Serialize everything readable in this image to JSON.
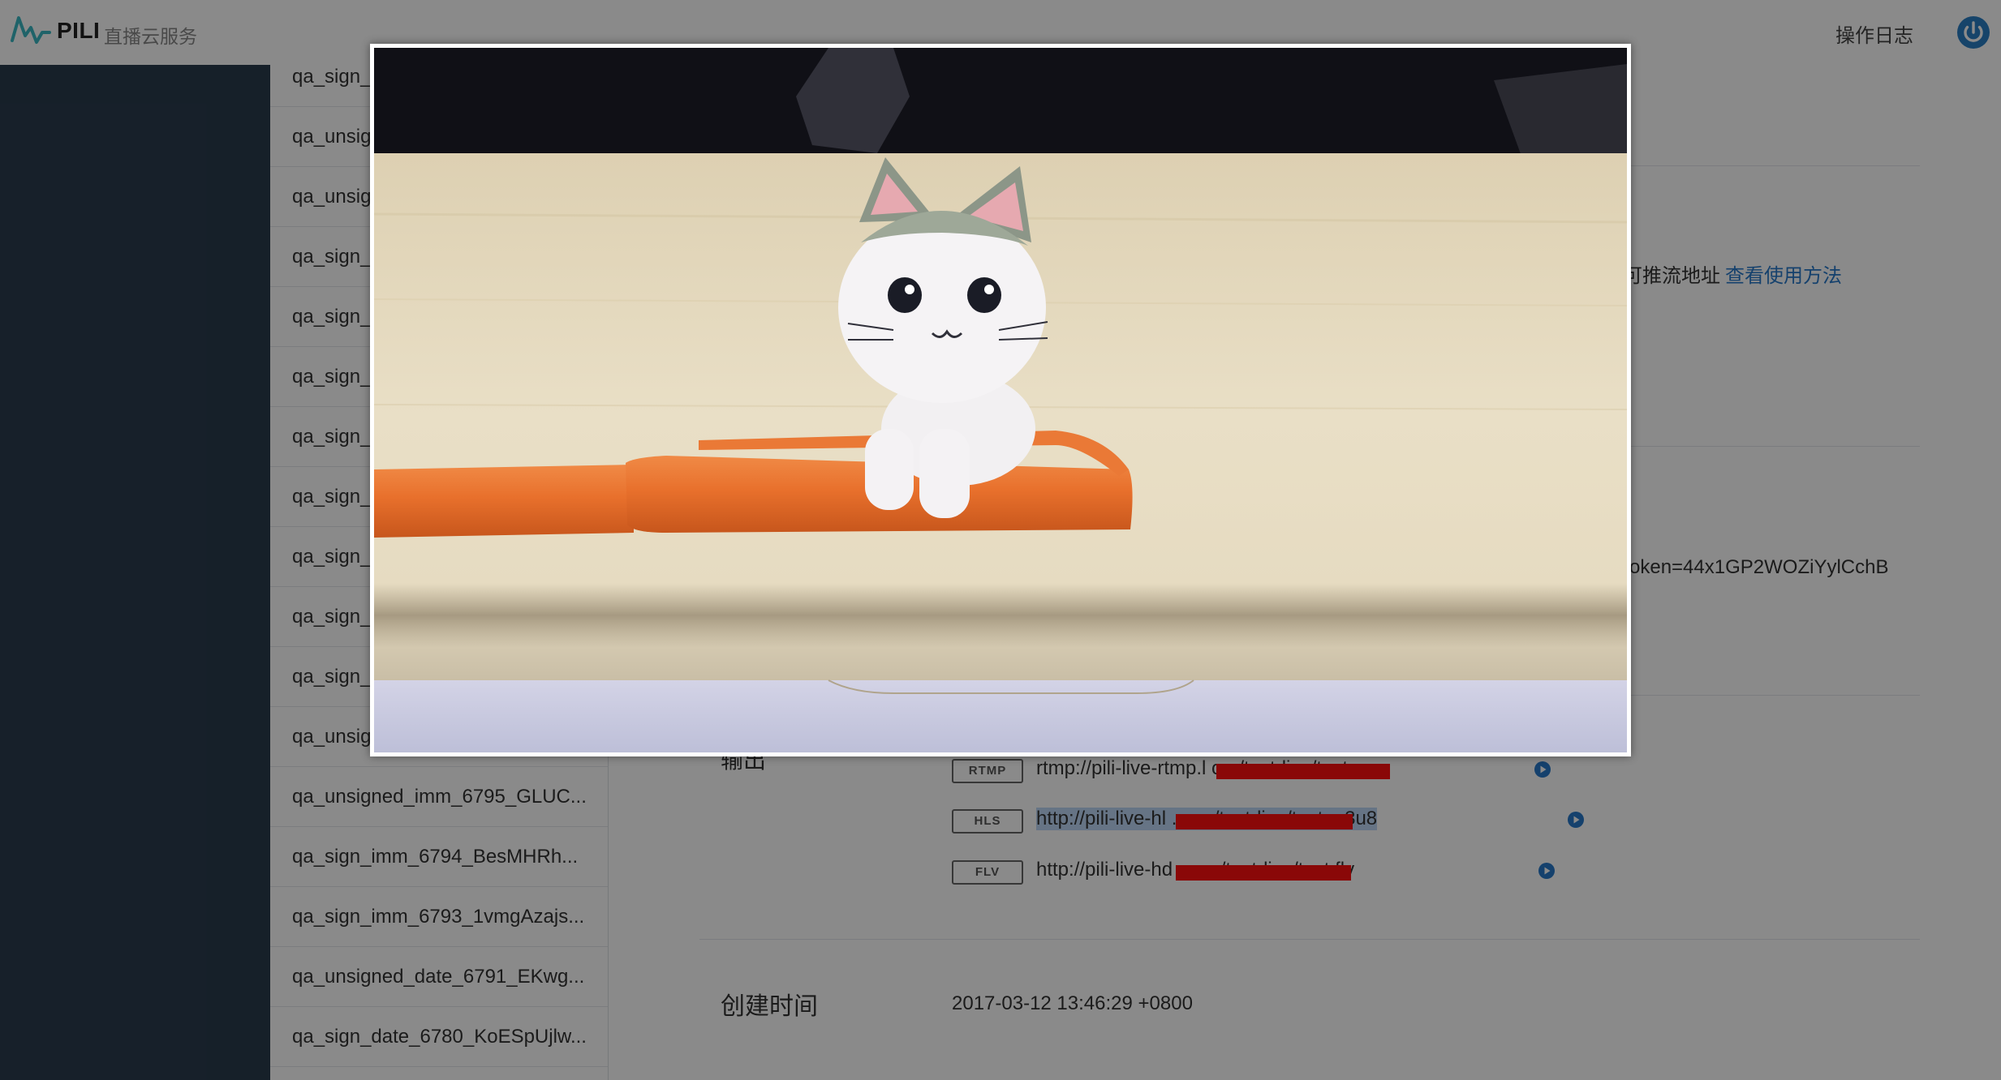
{
  "header": {
    "brand": "PILI",
    "brand_subtitle": "直播云服务",
    "operation_log": "操作日志"
  },
  "stream_list": [
    "qa_sign_",
    "qa_unsig",
    "qa_unsig",
    "qa_sign_",
    "qa_sign_",
    "qa_sign_",
    "qa_sign_",
    "qa_sign_",
    "qa_sign_",
    "qa_sign_",
    "qa_sign_",
    "qa_unsig",
    "qa_unsigned_imm_6795_GLUC...",
    "qa_sign_imm_6794_BesMHRh...",
    "qa_sign_imm_6793_1vmgAzajs...",
    "qa_unsigned_date_6791_EKwg...",
    "qa_sign_date_6780_KoESpUjlw..."
  ],
  "detail": {
    "push_hint_text": "可推流地址",
    "push_hint_link": "查看使用方法",
    "token_text": "oken=44x1GP2WOZiYylCchB",
    "output_label": "输出",
    "outputs": [
      {
        "protocol": "RTMP",
        "url": "rtmp://pili-live-rtmp.l                                    om/test-live/test",
        "selected": false
      },
      {
        "protocol": "HLS",
        "url": "http://pili-live-hl                                      .com/test-live/test.m3u8",
        "selected": true
      },
      {
        "protocol": "FLV",
        "url": "http://pili-live-hd                                      .com/test-live/test.flv",
        "selected": false
      }
    ],
    "created_label": "创建时间",
    "created_value": "2017-03-12 13:46:29 +0800"
  },
  "modal": {
    "content": "video-player-preview",
    "subject": "cat figurine sitting on an orange pen"
  },
  "colors": {
    "sidebar_bg": "#2a3c4d",
    "link": "#2879c9",
    "accent_power": "#2a7fc4",
    "redaction": "#ff0f0f",
    "selection": "#bcd6f5"
  }
}
